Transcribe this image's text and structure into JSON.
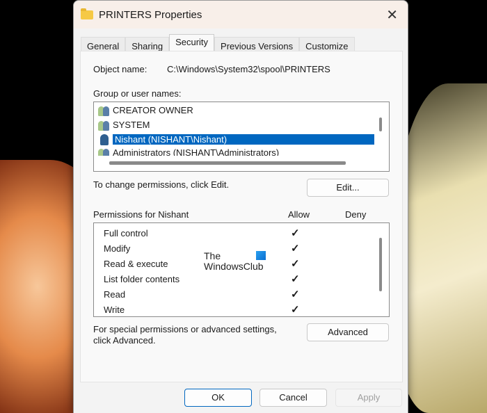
{
  "window": {
    "title": "PRINTERS Properties",
    "close_icon": "close-icon"
  },
  "tabs": [
    {
      "label": "General"
    },
    {
      "label": "Sharing"
    },
    {
      "label": "Security"
    },
    {
      "label": "Previous Versions"
    },
    {
      "label": "Customize"
    }
  ],
  "security": {
    "object_name_label": "Object name:",
    "object_name_value": "C:\\Windows\\System32\\spool\\PRINTERS",
    "group_label": "Group or user names:",
    "groups": [
      {
        "name": "CREATOR OWNER"
      },
      {
        "name": "SYSTEM"
      },
      {
        "name": "Nishant (NISHANT\\Nishant)"
      },
      {
        "name": "Administrators (NISHANT\\Administrators)"
      }
    ],
    "change_text": "To change permissions, click Edit.",
    "edit_button": "Edit...",
    "permissions_label": "Permissions for Nishant",
    "allow_header": "Allow",
    "deny_header": "Deny",
    "permissions": [
      {
        "name": "Full control",
        "allow": "✓"
      },
      {
        "name": "Modify",
        "allow": "✓"
      },
      {
        "name": "Read & execute",
        "allow": "✓"
      },
      {
        "name": "List folder contents",
        "allow": "✓"
      },
      {
        "name": "Read",
        "allow": "✓"
      },
      {
        "name": "Write",
        "allow": "✓"
      }
    ],
    "advanced_text_1": "For special permissions or advanced settings,",
    "advanced_text_2": "click Advanced.",
    "advanced_button": "Advanced"
  },
  "watermark": {
    "line1": "The",
    "line2": "WindowsClub"
  },
  "footer": {
    "ok": "OK",
    "cancel": "Cancel",
    "apply": "Apply"
  }
}
